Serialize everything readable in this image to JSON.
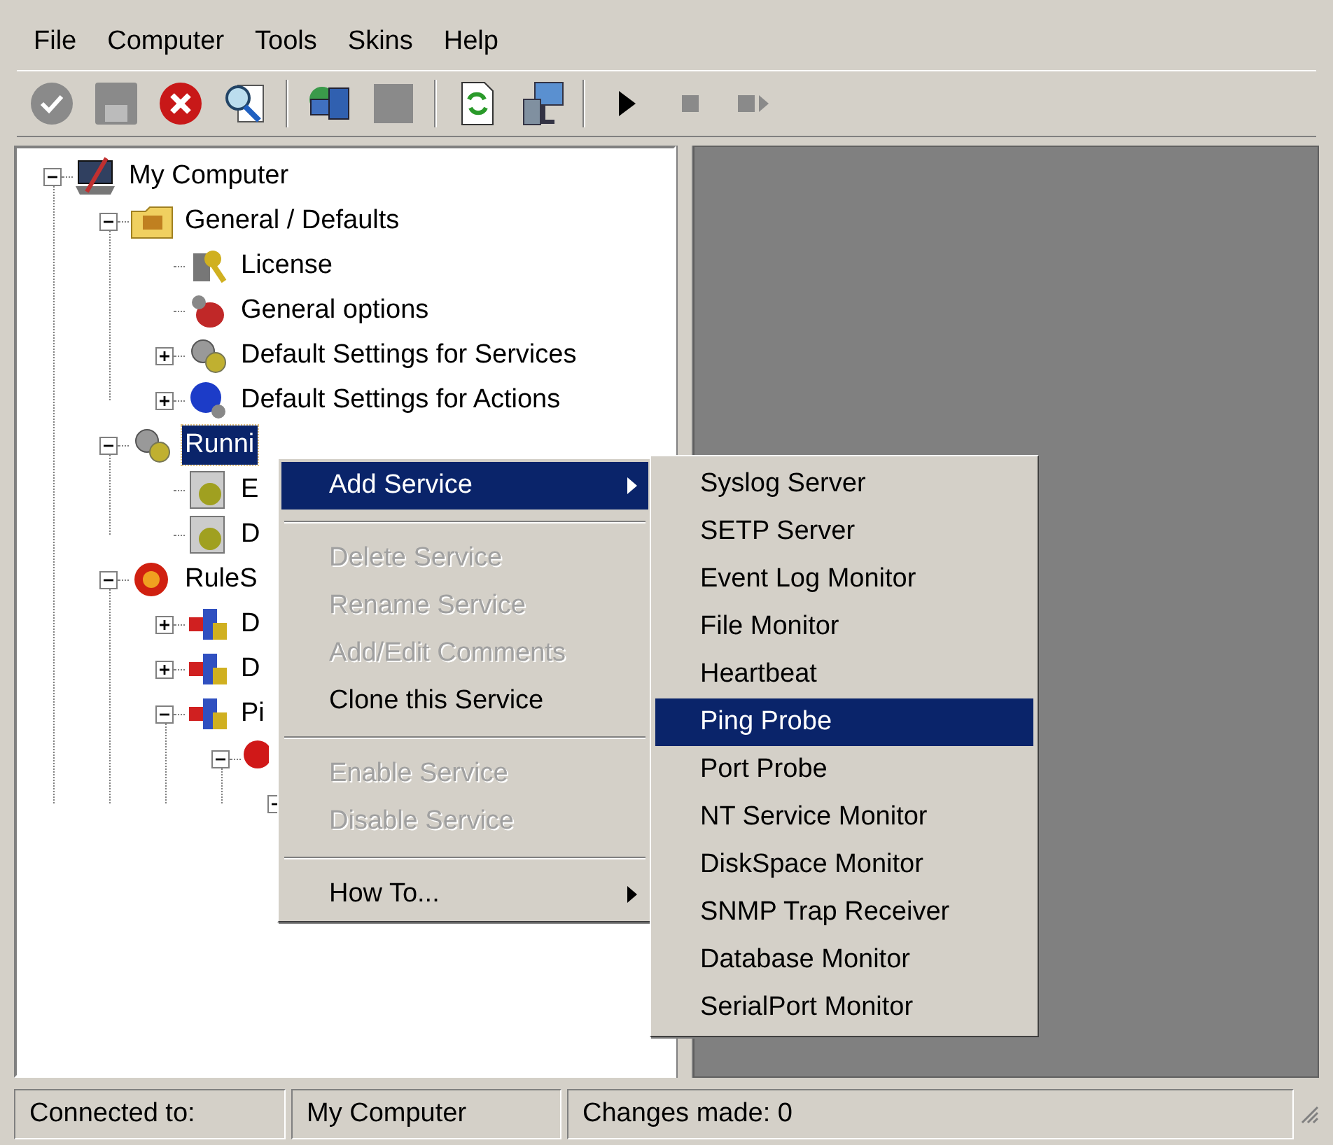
{
  "menu_bar": [
    "File",
    "Computer",
    "Tools",
    "Skins",
    "Help"
  ],
  "toolbar": [
    {
      "kind": "button",
      "disabled": true
    },
    {
      "kind": "button",
      "disabled": true
    },
    {
      "kind": "button",
      "disabled": false
    },
    {
      "kind": "button",
      "disabled": false
    },
    {
      "kind": "separator"
    },
    {
      "kind": "button",
      "disabled": false
    },
    {
      "kind": "button",
      "disabled": true
    },
    {
      "kind": "separator"
    },
    {
      "kind": "button",
      "disabled": false
    },
    {
      "kind": "button",
      "disabled": false
    },
    {
      "kind": "separator"
    },
    {
      "kind": "button",
      "disabled": false
    },
    {
      "kind": "button",
      "disabled": true
    },
    {
      "kind": "button",
      "disabled": true
    }
  ],
  "tree": [
    {
      "label": "My Computer",
      "expanded": true,
      "selected": false,
      "children": [
        {
          "label": "General / Defaults",
          "expanded": true,
          "selected": false,
          "children": [
            {
              "label": "License",
              "selected": false
            },
            {
              "label": "General options",
              "selected": false
            },
            {
              "label": "Default Settings for Services",
              "expanded": false,
              "selected": false
            },
            {
              "label": "Default Settings for Actions",
              "expanded": false,
              "selected": false
            }
          ]
        },
        {
          "label": "Runni",
          "expanded": true,
          "selected": true,
          "children": [
            {
              "label": "E",
              "selected": false
            },
            {
              "label": "D",
              "selected": false
            }
          ]
        },
        {
          "label": "RuleS",
          "expanded": true,
          "selected": false,
          "children": [
            {
              "label": "D",
              "expanded": false,
              "selected": false
            },
            {
              "label": "D",
              "expanded": false,
              "selected": false
            },
            {
              "label": "Pi",
              "expanded": true,
              "selected": false,
              "children": [
                {
                  "expanded": true,
                  "children": [
                    {
                      "expanded": true
                    }
                  ]
                }
              ]
            }
          ]
        }
      ]
    }
  ],
  "context_menu": [
    {
      "kind": "item",
      "label": "Add Service",
      "disabled": false,
      "selected": true,
      "submenu": true
    },
    {
      "kind": "separator"
    },
    {
      "kind": "item",
      "label": "Delete Service",
      "disabled": true,
      "selected": false,
      "submenu": false
    },
    {
      "kind": "item",
      "label": "Rename Service",
      "disabled": true,
      "selected": false,
      "submenu": false
    },
    {
      "kind": "item",
      "label": "Add/Edit Comments",
      "disabled": true,
      "selected": false,
      "submenu": false
    },
    {
      "kind": "item",
      "label": "Clone this Service",
      "disabled": false,
      "selected": false,
      "submenu": false
    },
    {
      "kind": "separator"
    },
    {
      "kind": "item",
      "label": "Enable Service",
      "disabled": true,
      "selected": false,
      "submenu": false
    },
    {
      "kind": "item",
      "label": "Disable Service",
      "disabled": true,
      "selected": false,
      "submenu": false
    },
    {
      "kind": "separator"
    },
    {
      "kind": "item",
      "label": "How To...",
      "disabled": false,
      "selected": false,
      "submenu": true
    }
  ],
  "submenu": [
    {
      "label": "Syslog Server",
      "selected": false
    },
    {
      "label": "SETP Server",
      "selected": false
    },
    {
      "label": "Event Log Monitor",
      "selected": false
    },
    {
      "label": "File Monitor",
      "selected": false
    },
    {
      "label": "Heartbeat",
      "selected": false
    },
    {
      "label": "Ping Probe",
      "selected": true
    },
    {
      "label": "Port Probe",
      "selected": false
    },
    {
      "label": "NT Service Monitor",
      "selected": false
    },
    {
      "label": "DiskSpace Monitor",
      "selected": false
    },
    {
      "label": "SNMP Trap Receiver",
      "selected": false
    },
    {
      "label": "Database Monitor",
      "selected": false
    },
    {
      "label": "SerialPort Monitor",
      "selected": false
    }
  ],
  "status_bar": [
    "Connected to:",
    "My Computer",
    "Changes made: 0"
  ]
}
